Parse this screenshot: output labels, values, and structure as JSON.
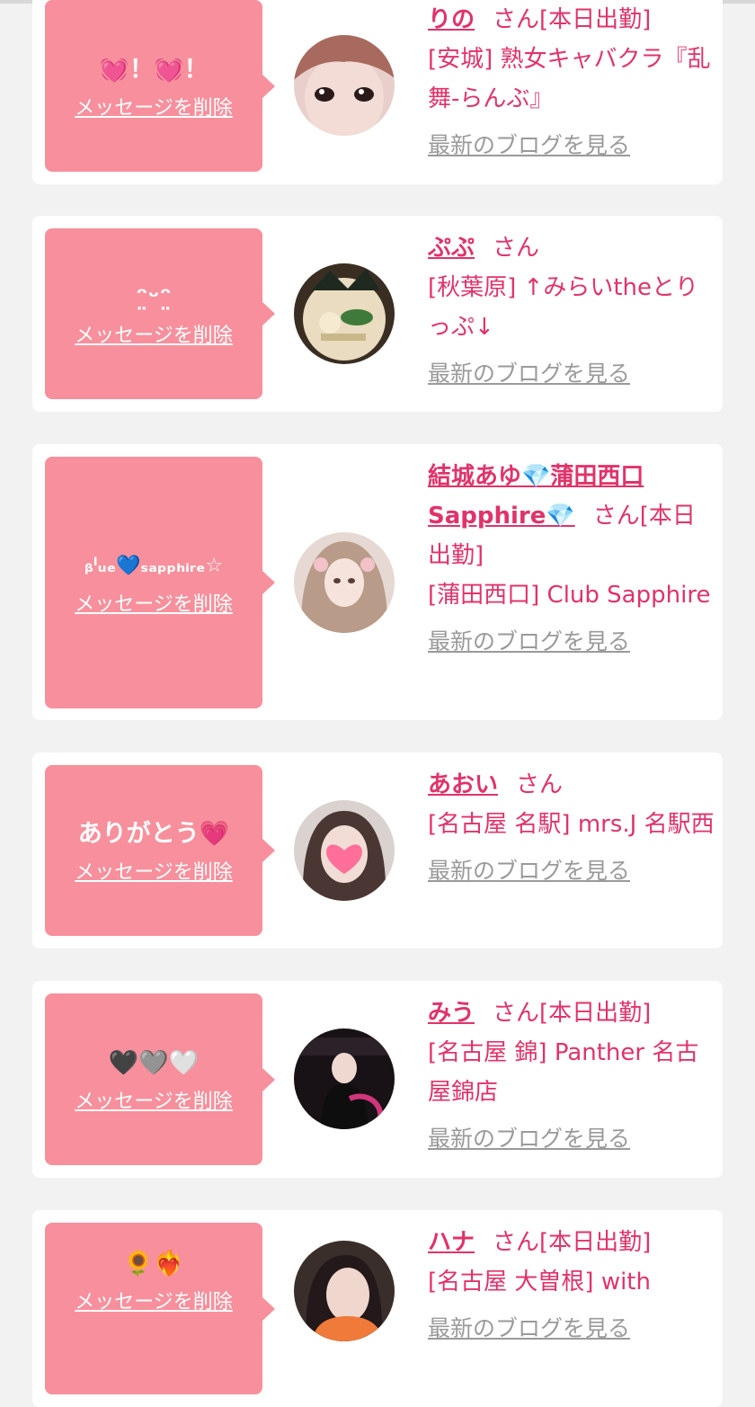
{
  "labels": {
    "delete": "メッセージを削除",
    "blog": "最新のブログを見る"
  },
  "cards": [
    {
      "message": "💓！💓！",
      "name": "りの",
      "honorific": "さん",
      "status": "[本日出勤]",
      "shop": "[安城] 熟女キャバクラ『乱舞-らんぶ』"
    },
    {
      "message": "ᵔ̤ᵕᵔ̤",
      "name": "ぷぷ",
      "honorific": "さん",
      "status": "",
      "shop": "[秋葉原] ↑みらいtheとりっぷ↓"
    },
    {
      "message": "ᵦˡᵤₑ💙ₛₐₚₚₕᵢᵣₑ☆",
      "name": "結城あゆ💎蒲田西口Sapphire💎",
      "honorific": "さん",
      "status": "[本日出勤]",
      "shop": "[蒲田西口] Club Sapphire"
    },
    {
      "message": "ありがとう💗",
      "name": "あおい",
      "honorific": "さん",
      "status": "",
      "shop": "[名古屋 名駅] mrs.J 名駅西"
    },
    {
      "message": "🖤🩶🤍",
      "name": "みう",
      "honorific": "さん",
      "status": "[本日出勤]",
      "shop": "[名古屋 錦] Panther 名古屋錦店"
    },
    {
      "message": "🌻❤️‍🔥",
      "name": "ハナ",
      "honorific": "さん",
      "status": "[本日出勤]",
      "shop": "[名古屋 大曽根] with"
    }
  ]
}
